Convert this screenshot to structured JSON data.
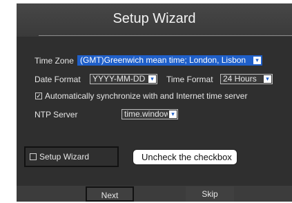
{
  "dialog": {
    "title": "Setup Wizard"
  },
  "time_zone": {
    "label": "Time Zone",
    "value": "(GMT)Greenwich mean time; London, Lisbon"
  },
  "date_format": {
    "label": "Date Format",
    "value": "YYYY-MM-DD"
  },
  "time_format": {
    "label": "Time Format",
    "value": "24 Hours"
  },
  "auto_sync": {
    "checked": true,
    "label": "Automatically synchronize with and Internet time server"
  },
  "ntp_server": {
    "label": "NTP Server",
    "value": "time.windows.com"
  },
  "setup_wizard_checkbox": {
    "checked": false,
    "label": "Setup Wizard"
  },
  "callout": {
    "text": "Uncheck the checkbox"
  },
  "buttons": {
    "next": "Next",
    "skip": "Skip"
  },
  "colors": {
    "dialog_bg": "#2f2f2f",
    "highlight": "#1f5fc9",
    "text": "#e6e6e6"
  }
}
